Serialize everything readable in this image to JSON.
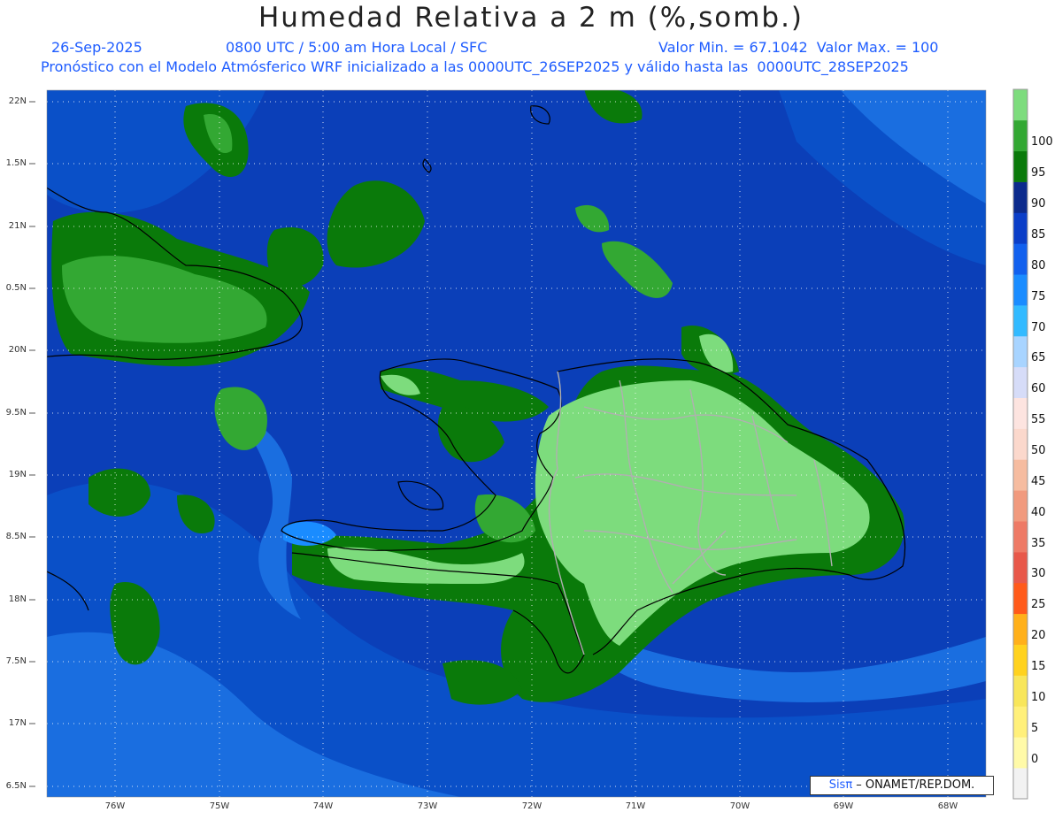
{
  "title": "Humedad Relativa a 2 m (%,somb.)",
  "date": "26-Sep-2025",
  "time_info": "0800 UTC / 5:00 am Hora Local / SFC",
  "minmax": "Valor Min. = 67.1042  Valor Max. = 100",
  "forecast_info": "Pronóstico con el Modelo Atmósferico WRF inicializado a las 0000UTC_26SEP2025 y válido hasta las  0000UTC_28SEP2025",
  "lat_labels": [
    "22N",
    "1.5N",
    "21N",
    "0.5N",
    "20N",
    "9.5N",
    "19N",
    "8.5N",
    "18N",
    "7.5N",
    "17N",
    "6.5N"
  ],
  "lon_labels": [
    "76W",
    "75W",
    "74W",
    "73W",
    "72W",
    "71W",
    "70W",
    "69W",
    "68W"
  ],
  "colorbar": {
    "labels": [
      "0",
      "5",
      "10",
      "15",
      "20",
      "25",
      "30",
      "35",
      "40",
      "45",
      "50",
      "55",
      "60",
      "65",
      "70",
      "75",
      "80",
      "85",
      "90",
      "95",
      "100"
    ],
    "colors": [
      "#f2f2f2",
      "#fffaa8",
      "#fff07a",
      "#f8e65a",
      "#ffd21e",
      "#ffb01a",
      "#ff5a1a",
      "#e8584a",
      "#ee7a66",
      "#f19a7e",
      "#f6bca0",
      "#fbd8cc",
      "#fde4e0",
      "#d6dcf8",
      "#a8d4ff",
      "#32baff",
      "#1a8cff",
      "#1160ee",
      "#0a3ec8",
      "#0b2a8c",
      "#0a7a0a",
      "#33a833",
      "#7ddc7d"
    ]
  },
  "credit": {
    "sis": "Sisπ",
    "org": " – ONAMET/REP.DOM."
  },
  "colors": {
    "ocean_deep": "#0b3fb8",
    "ocean_mid": "#0a50c8",
    "ocean_light": "#1a6ee0",
    "rh_90": "#0a7a0a",
    "rh_95": "#33a833",
    "rh_100": "#7ddc7d",
    "land_line": "#000000",
    "border_line": "#b0b0b0"
  }
}
